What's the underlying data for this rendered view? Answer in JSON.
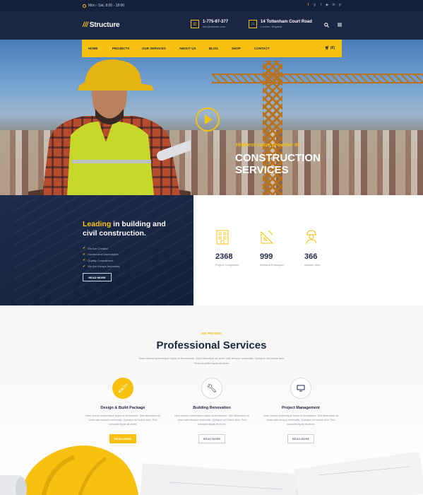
{
  "topbar": {
    "hours": "Mon - Sat, 8:00 - 18:00",
    "social_icons": [
      "facebook-icon",
      "google-plus-icon",
      "twitter-icon",
      "youtube-icon",
      "linkedin-icon",
      "pinterest-icon"
    ]
  },
  "header": {
    "logo_text": "Structure",
    "phone": "1-775-97-377",
    "email": "info@domain.com",
    "address_line1": "14 Tottenham Court Road",
    "address_line2": "London, England"
  },
  "nav": {
    "items": [
      "HOME",
      "PROJECTS",
      "OUR SERVICES",
      "ABOUT US",
      "BLOG",
      "SHOP",
      "CONTACT"
    ],
    "cart": "(0)"
  },
  "hero": {
    "subtitle": "Highest value provider of",
    "title_line1": "CONSTRUCTION",
    "title_line2": "SERVICES"
  },
  "about": {
    "title_highlight": "Leading",
    "title_rest1": " in building and",
    "title_rest2": "civil construction.",
    "list": [
      "We Are Creative",
      "Honest And Dependable",
      "Quality Commitment",
      "We Are Always Improving"
    ],
    "button": "READ MORE"
  },
  "stats": [
    {
      "icon": "building-icon",
      "value": "2368",
      "label": "Project Completed"
    },
    {
      "icon": "ruler-icon",
      "value": "999",
      "label": "Workers Employed"
    },
    {
      "icon": "worker-icon",
      "value": "366",
      "label": "Awards Won"
    }
  ],
  "services": {
    "kicker": "WE PROVIDE",
    "title": "Professional Services",
    "description": "Nam viverra scelerisque turpis et fermentum. Sed bibendum sit amet odio tempor venenatis. Quisque vel lectus sem. Sed convallis ligula sit amet.",
    "cards": [
      {
        "icon": "brush-icon",
        "title": "Design  & Build Package",
        "desc": "Nam viverra scelerisque turpis et fermentum. Sed bibendum sit amet odio tempor venenatis. Quisque vel lectus sem. Sed convallis ligula sit amet.",
        "button": "READ MORE"
      },
      {
        "icon": "wrench-icon",
        "title": "Building Renovation",
        "desc": "Nam viverra scelerisque turpis et fermentum. Sed bibendum sit amet odio tempor venenatis. Quisque vel lectus sem. Sed convallis ligula sit amet.",
        "button": "READ MORE"
      },
      {
        "icon": "monitor-icon",
        "title": "Project Management",
        "desc": "Nam viverra scelerisque turpis et fermentum. Sed bibendum sit amet odio tempor venenatis. Quisque vel lectus sem. Sed convallis ligula sit amet.",
        "button": "READ MORE"
      }
    ]
  },
  "colors": {
    "accent": "#f7c10f",
    "navy": "#1b2642",
    "dark_navy": "#15213a"
  }
}
